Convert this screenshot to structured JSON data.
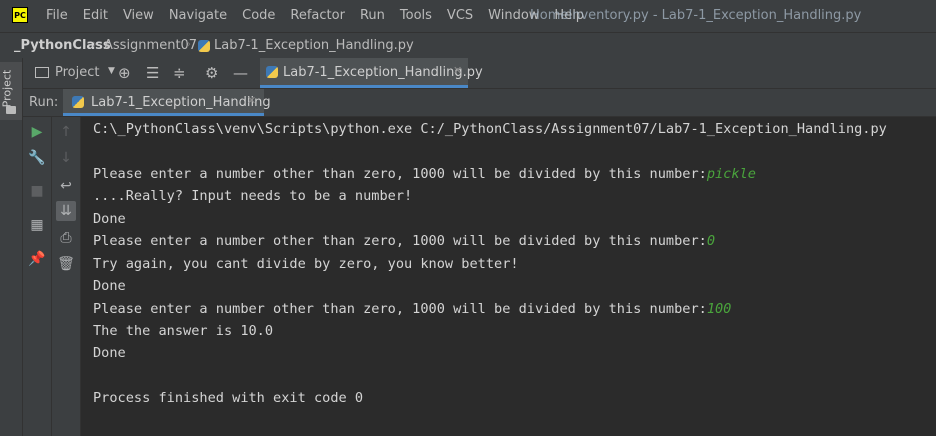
{
  "app": {
    "logo": "PC",
    "menu": [
      "File",
      "Edit",
      "View",
      "Navigate",
      "Code",
      "Refactor",
      "Run",
      "Tools",
      "VCS",
      "Window",
      "Help"
    ],
    "window_title": "HomeInventory.py - Lab7-1_Exception_Handling.py"
  },
  "breadcrumb": {
    "project": "_PythonClass",
    "folder": "Assignment07",
    "file": "Lab7-1_Exception_Handling.py"
  },
  "left_stripe": {
    "project_label": "Project"
  },
  "toolbar": {
    "project_label": "Project",
    "editor_tab": "Lab7-1_Exception_Handling.py"
  },
  "run": {
    "label": "Run:",
    "tab": "Lab7-1_Exception_Handling"
  },
  "console": {
    "command": "C:\\_PythonClass\\venv\\Scripts\\python.exe C:/_PythonClass/Assignment07/Lab7-1_Exception_Handling.py",
    "prompt": "Please enter a number other than zero, 1000 will be divided by this number:",
    "inputs": [
      "pickle",
      "0",
      "100"
    ],
    "value_error_msg": "....Really? Input needs to be a number!",
    "zero_error_msg": "Try again, you cant divide by zero, you know better!",
    "answer_msg": "The the answer is 10.0",
    "done": "Done",
    "exit_msg": "Process finished with exit code 0"
  },
  "icons": {
    "run": "play-icon",
    "settings": "wrench-icon",
    "stop": "stop-icon",
    "layout": "layout-icon",
    "pin": "pin-icon",
    "up": "arrow-up-icon",
    "down": "arrow-down-icon",
    "wrap": "soft-wrap-icon",
    "scroll": "scroll-to-end-icon",
    "print": "print-icon",
    "trash": "trash-icon"
  },
  "colors": {
    "user_input": "#4aa43c",
    "accent": "#4a88c7"
  }
}
